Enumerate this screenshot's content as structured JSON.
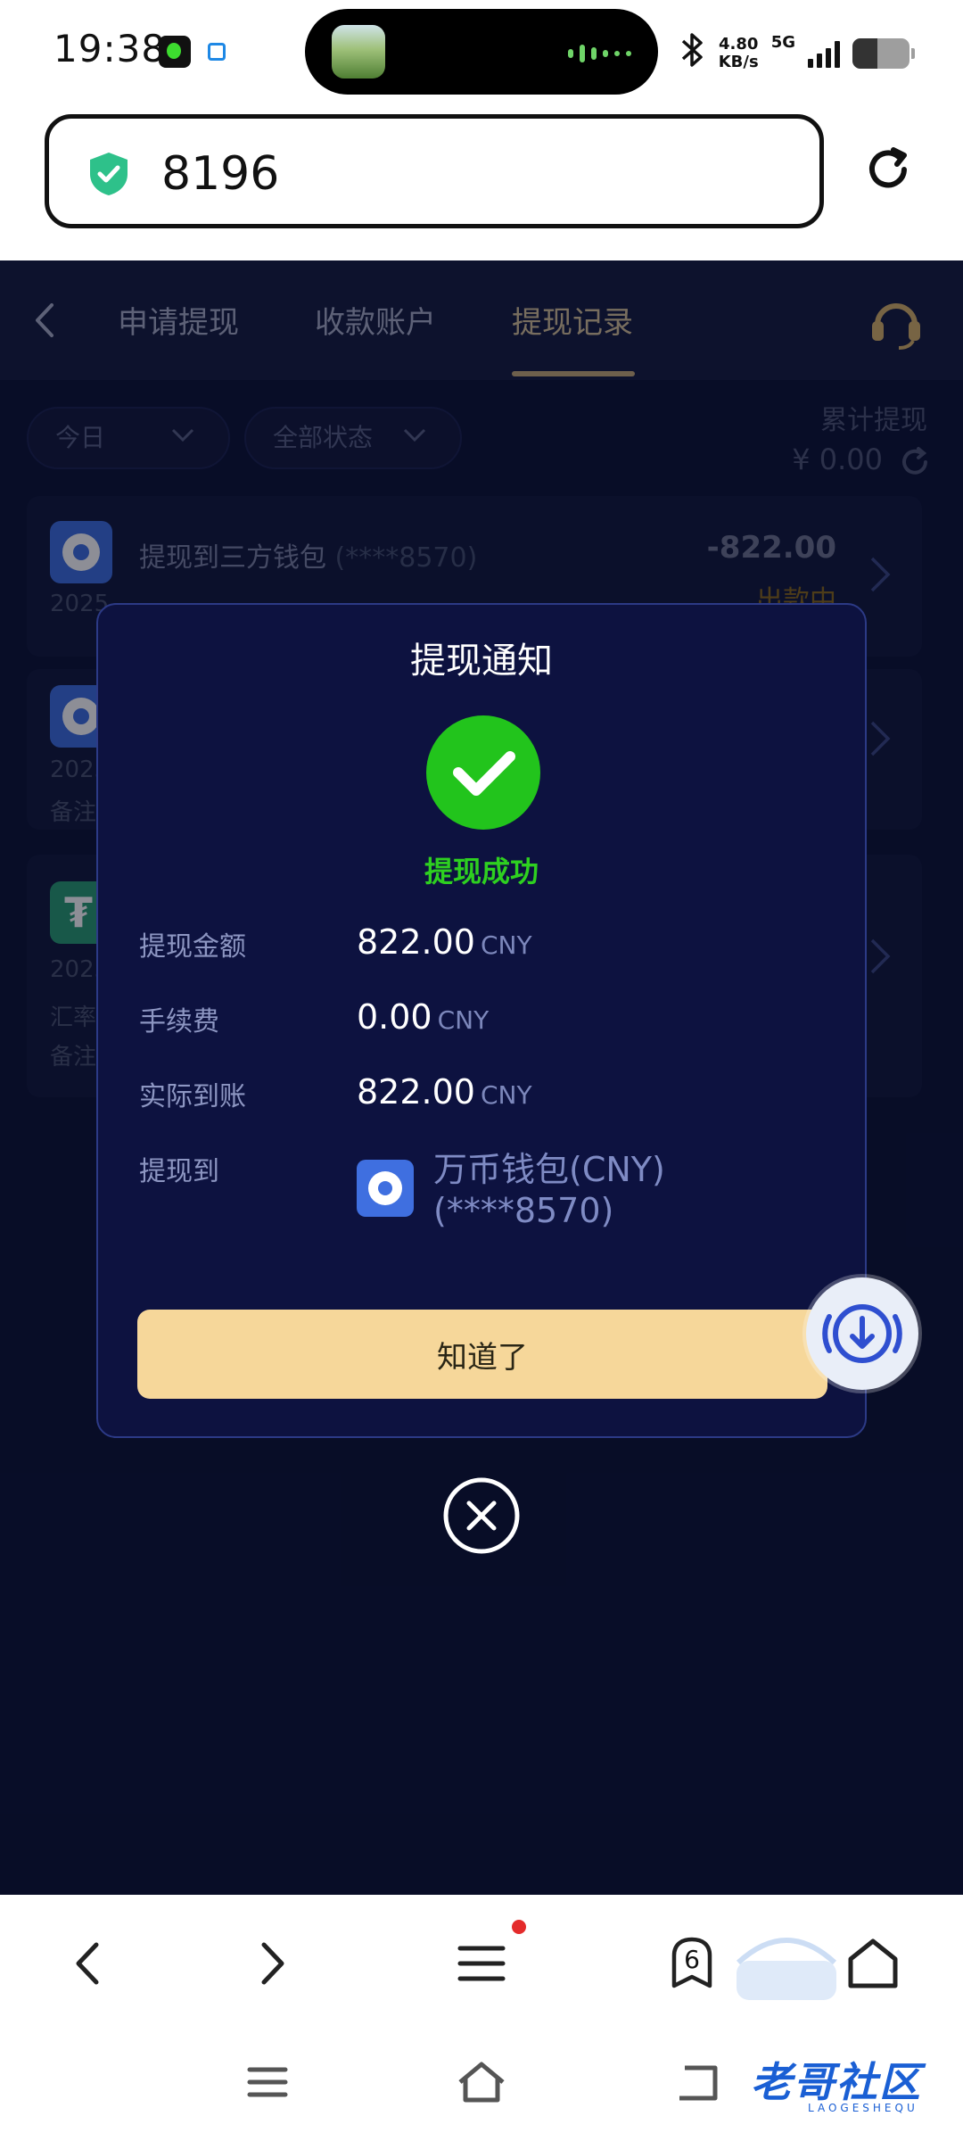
{
  "status_bar": {
    "time": "19:38",
    "speed_value": "4.80",
    "speed_unit": "KB/s",
    "network": "5G"
  },
  "browser": {
    "url": "8196"
  },
  "header": {
    "tabs": [
      {
        "label": "申请提现",
        "active": false
      },
      {
        "label": "收款账户",
        "active": false
      },
      {
        "label": "提现记录",
        "active": true
      }
    ]
  },
  "filters": {
    "date": "今日",
    "status": "全部状态",
    "total_label": "累计提现",
    "total_amount": "¥ 0.00"
  },
  "records": [
    {
      "title": "提现到三方钱包",
      "account": "(****8570)",
      "amount": "-822.00",
      "status": "出款中",
      "date": "2025"
    },
    {
      "date": "2025",
      "note_label": "备注"
    },
    {
      "date": "2025",
      "rate_label": "汇率",
      "note_label": "备注"
    }
  ],
  "dialog": {
    "title": "提现通知",
    "success_text": "提现成功",
    "rows": [
      {
        "label": "提现金额",
        "value": "822.00",
        "unit": "CNY"
      },
      {
        "label": "手续费",
        "value": "0.00",
        "unit": "CNY"
      },
      {
        "label": "实际到账",
        "value": "822.00",
        "unit": "CNY"
      }
    ],
    "withdraw_to_label": "提现到",
    "wallet_name_line1": "万币钱包(CNY)",
    "wallet_name_line2": "(****8570)",
    "confirm_label": "知道了"
  },
  "bottom_bar": {
    "tab_count": "6"
  },
  "watermark": {
    "text": "老哥社区",
    "sub": "LAOGESHEQU"
  },
  "colors": {
    "app_background": "#0d1436",
    "accent_gold": "#c6ab78",
    "success_green": "#2ed020",
    "button_fill": "#f6d79a"
  }
}
